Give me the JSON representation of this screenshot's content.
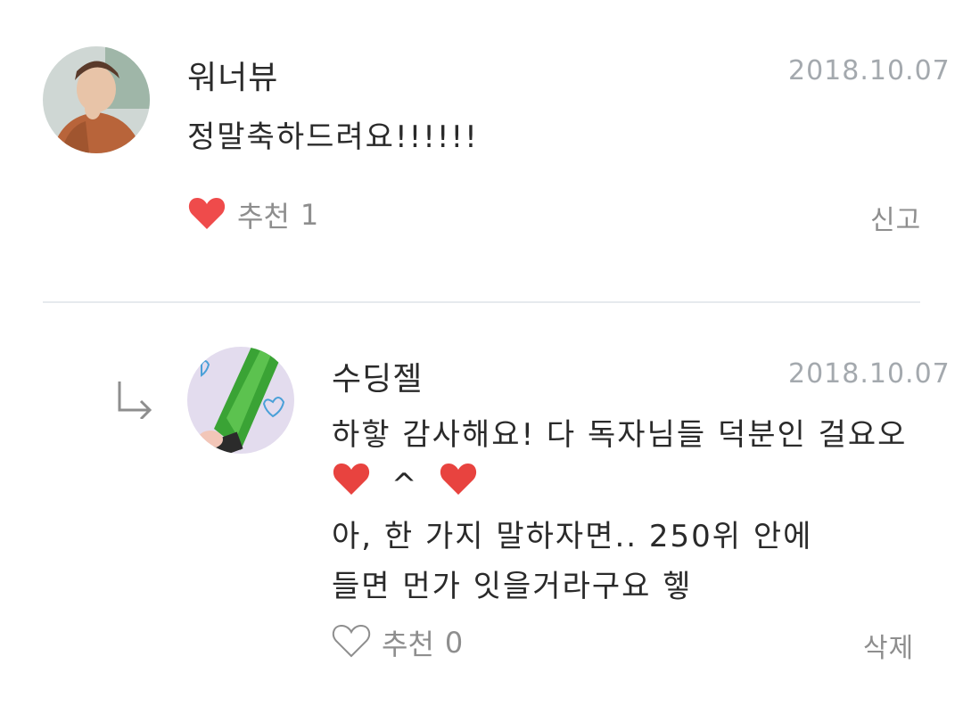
{
  "comments": [
    {
      "username": "워너뷰",
      "date": "2018.10.07",
      "text_lines": [
        "정말축하드려요!!!!!!"
      ],
      "like_label": "추천",
      "like_count": "1",
      "liked": true,
      "action": "신고"
    },
    {
      "username": "수딩젤",
      "date": "2018.10.07",
      "text_lines": [
        "하핳 감사해요! 다 독자님들 덕분인 걸요오",
        "^",
        "아, 한 가지 말하자면..  250위 안에",
        "들면 먼가 잇을거라구요 헿"
      ],
      "like_label": "추천",
      "like_count": "0",
      "liked": false,
      "action": "삭제"
    }
  ],
  "colors": {
    "heart": "#e8433f",
    "muted": "#8e8e8e",
    "date": "#a4a9ae",
    "divider": "#e6eaee"
  },
  "icons": [
    "heart-filled-icon",
    "heart-outline-icon",
    "reply-arrow-icon"
  ]
}
